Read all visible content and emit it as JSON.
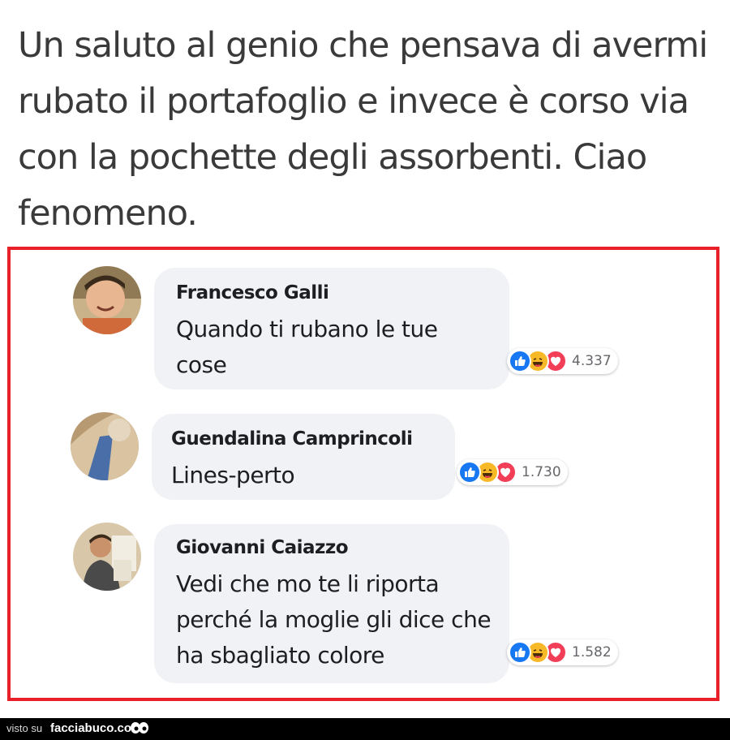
{
  "post": {
    "text": "Un saluto al genio che pensava di avermi rubato il portafoglio e invece è corso via con la pochette degli assorbenti. Ciao fenomeno."
  },
  "comments": [
    {
      "author": "Francesco Galli",
      "text": "Quando ti rubano le tue cose",
      "reaction_count": "4.337"
    },
    {
      "author": "Guendalina Camprincoli",
      "text": "Lines-perto",
      "reaction_count": "1.730"
    },
    {
      "author": "Giovanni Caiazzo",
      "text": "Vedi che mo te li riporta perché la moglie gli dice che ha sbagliato colore",
      "reaction_count": "1.582"
    }
  ],
  "reaction_icons": [
    "like-icon",
    "haha-icon",
    "love-icon"
  ],
  "colors": {
    "frame": "#e8202a",
    "like": "#1877f2",
    "haha": "#f7b928",
    "love": "#f33e58",
    "bubble": "#f0f2f5"
  },
  "footer": {
    "prefix": "visto su",
    "brand": "facciabuco.com"
  }
}
